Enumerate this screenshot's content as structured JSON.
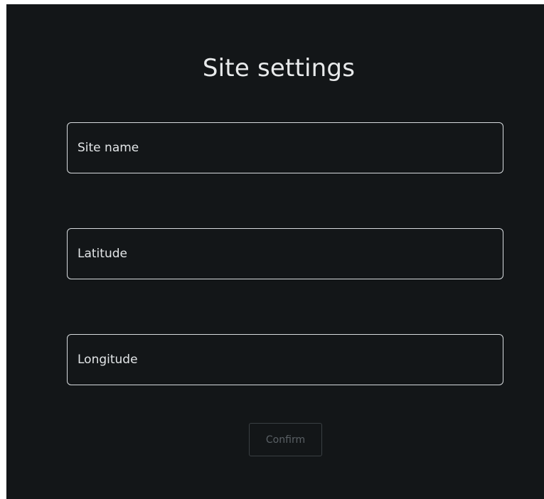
{
  "dialog": {
    "title": "Site settings",
    "fields": [
      {
        "placeholder": "Site name",
        "value": ""
      },
      {
        "placeholder": "Latitude",
        "value": ""
      },
      {
        "placeholder": "Longitude",
        "value": ""
      }
    ],
    "confirm_label": "Confirm",
    "confirm_disabled": true
  },
  "colors": {
    "background": "#131618",
    "field_border": "#d7dbde",
    "text": "#e8eaeb",
    "disabled_button_text": "#5a6065",
    "disabled_button_border": "#3a3f43"
  }
}
